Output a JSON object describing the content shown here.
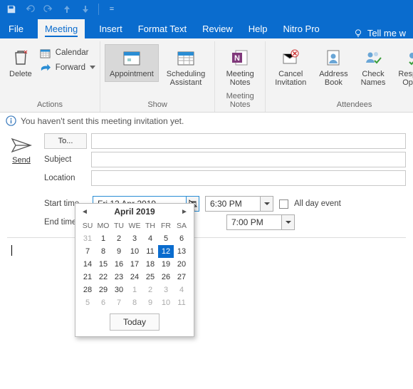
{
  "titlebar": {
    "separator": "="
  },
  "tabs": {
    "file": "File",
    "meeting": "Meeting",
    "insert": "Insert",
    "formatText": "Format Text",
    "review": "Review",
    "help": "Help",
    "nitroPro": "Nitro Pro",
    "tellMe": "Tell me w"
  },
  "ribbon": {
    "actions": {
      "label": "Actions",
      "delete": "Delete",
      "calendar": "Calendar",
      "forward": "Forward"
    },
    "show": {
      "label": "Show",
      "appointment": "Appointment",
      "scheduling": "Scheduling\nAssistant"
    },
    "meetingNotes": {
      "label": "Meeting Notes",
      "button": "Meeting\nNotes"
    },
    "attendees": {
      "label": "Attendees",
      "cancel": "Cancel\nInvitation",
      "addressBook": "Address\nBook",
      "checkNames": "Check\nNames",
      "responseOptions": "Response\nOptions"
    }
  },
  "info": "You haven't sent this meeting invitation yet.",
  "form": {
    "send": "Send",
    "to": "To...",
    "subjectLabel": "Subject",
    "locationLabel": "Location",
    "startLabel": "Start time",
    "endLabel": "End time",
    "startDate": "Fri 12 Apr 2019",
    "startTime": "6:30 PM",
    "endTime": "7:00 PM",
    "allDay": "All day event"
  },
  "datepicker": {
    "month": "April 2019",
    "dayHeaders": [
      "SU",
      "MO",
      "TU",
      "WE",
      "TH",
      "FR",
      "SA"
    ],
    "weeks": [
      [
        {
          "d": "31",
          "o": true
        },
        {
          "d": "1"
        },
        {
          "d": "2"
        },
        {
          "d": "3"
        },
        {
          "d": "4"
        },
        {
          "d": "5"
        },
        {
          "d": "6"
        }
      ],
      [
        {
          "d": "7"
        },
        {
          "d": "8"
        },
        {
          "d": "9"
        },
        {
          "d": "10"
        },
        {
          "d": "11"
        },
        {
          "d": "12",
          "sel": true
        },
        {
          "d": "13"
        }
      ],
      [
        {
          "d": "14"
        },
        {
          "d": "15"
        },
        {
          "d": "16"
        },
        {
          "d": "17"
        },
        {
          "d": "18"
        },
        {
          "d": "19"
        },
        {
          "d": "20"
        }
      ],
      [
        {
          "d": "21"
        },
        {
          "d": "22"
        },
        {
          "d": "23"
        },
        {
          "d": "24"
        },
        {
          "d": "25"
        },
        {
          "d": "26"
        },
        {
          "d": "27"
        }
      ],
      [
        {
          "d": "28"
        },
        {
          "d": "29"
        },
        {
          "d": "30"
        },
        {
          "d": "1",
          "o": true
        },
        {
          "d": "2",
          "o": true
        },
        {
          "d": "3",
          "o": true
        },
        {
          "d": "4",
          "o": true
        }
      ],
      [
        {
          "d": "5",
          "o": true
        },
        {
          "d": "6",
          "o": true
        },
        {
          "d": "7",
          "o": true
        },
        {
          "d": "8",
          "o": true
        },
        {
          "d": "9",
          "o": true
        },
        {
          "d": "10",
          "o": true
        },
        {
          "d": "11",
          "o": true
        }
      ]
    ],
    "today": "Today"
  }
}
